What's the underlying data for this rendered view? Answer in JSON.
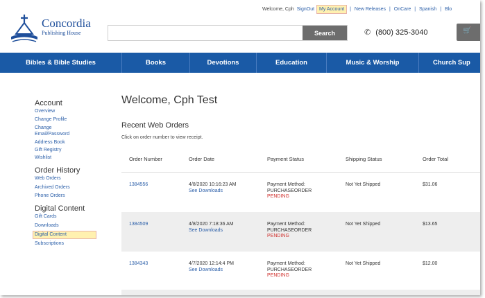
{
  "header": {
    "utility": {
      "welcome": "Welcome, Cph",
      "sign_out": "SignOut",
      "my_account": "My Account",
      "new_releases": "New Releases",
      "oncare": "OnCare",
      "spanish": "Spanish",
      "blog": "Blo",
      "separator": "|"
    },
    "logo": {
      "title": "Concordia",
      "subtitle": "Publishing House"
    },
    "search": {
      "placeholder": "",
      "button": "Search"
    },
    "phone": "(800) 325-3040",
    "cart_icon": "cart-icon"
  },
  "nav": {
    "items": [
      {
        "label": "Bibles & Bible Studies"
      },
      {
        "label": "Books"
      },
      {
        "label": "Devotions"
      },
      {
        "label": "Education"
      },
      {
        "label": "Music & Worship"
      },
      {
        "label": "Church Sup"
      }
    ]
  },
  "sidebar": {
    "account_heading": "Account",
    "account_items": [
      "Overview",
      "Change Profile",
      "Change",
      "Email/Password",
      "Address Book",
      "Gift Registry",
      "Wishlist"
    ],
    "order_heading": "Order History",
    "order_items": [
      "Web Orders",
      "Archived Orders",
      "Phone Orders"
    ],
    "digital_heading": "Digital Content",
    "digital_items": [
      "Gift Cards",
      "Downloads",
      "Digital Content",
      "Subscriptions"
    ]
  },
  "main": {
    "title": "Welcome, Cph Test",
    "subtitle": "Recent Web Orders",
    "hint": "Click on order number to view receipt.",
    "columns": [
      "Order Number",
      "Order Date",
      "Payment Status",
      "Shipping Status",
      "Order Total"
    ],
    "rows": [
      {
        "number": "1384556",
        "date": "4/8/2020 10:16:23 AM",
        "downloads": "See Downloads",
        "pay1": "Payment Method:",
        "pay2": "PURCHASEORDER",
        "status": "PENDING",
        "shipping": "Not Yet Shipped",
        "total": "$31.06"
      },
      {
        "number": "1384509",
        "date": "4/8/2020 7:18:36 AM",
        "downloads": "See Downloads",
        "pay1": "Payment Method:",
        "pay2": "PURCHASEORDER",
        "status": "PENDING",
        "shipping": "Not Yet Shipped",
        "total": "$13.65"
      },
      {
        "number": "1384343",
        "date": "4/7/2020 12:14:4 PM",
        "downloads": "See Downloads",
        "pay1": "Payment Method:",
        "pay2": "PURCHASEORDER",
        "status": "PENDING",
        "shipping": "Not Yet Shipped",
        "total": "$12.00"
      }
    ]
  },
  "colors": {
    "brand_blue": "#1a5aa6",
    "link": "#2a5ea8",
    "pending": "#d0312d",
    "highlight": "#fff1b0"
  }
}
